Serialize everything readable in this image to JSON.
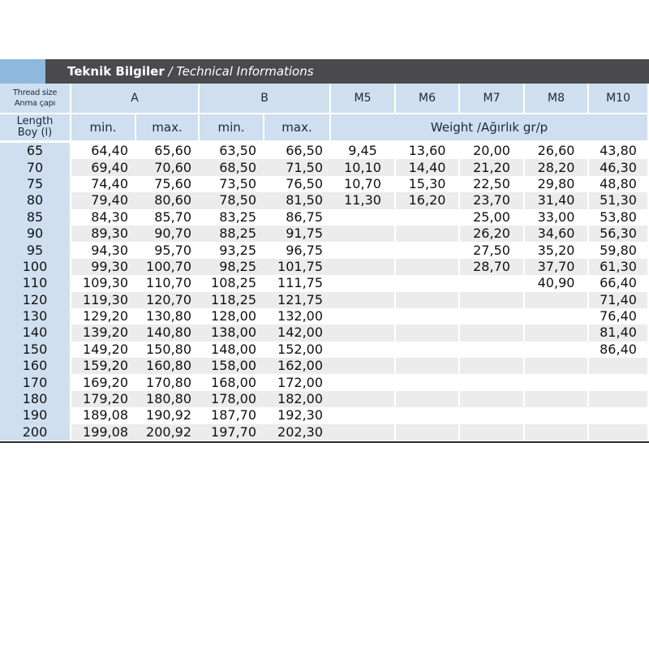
{
  "banner": {
    "title_tr": "Teknik Bilgiler",
    "separator": " / ",
    "title_en": "Technical Informations",
    "accent_color": "#8fb8de",
    "bar_color": "#4a4a4c"
  },
  "header": {
    "thread_size_en": "Thread size",
    "thread_size_tr": "Anma çapı",
    "col_a": "A",
    "col_b": "B",
    "threads": [
      "M5",
      "M6",
      "M7",
      "M8",
      "M10"
    ],
    "length_en": "Length",
    "length_tr": "Boy (l)",
    "min": "min.",
    "max": "max.",
    "weight": "Weight /Ağırlık gr/p"
  },
  "rows": [
    {
      "length": "65",
      "a_min": "64,40",
      "a_max": "65,60",
      "b_min": "63,50",
      "b_max": "66,50",
      "w": [
        "9,45",
        "13,60",
        "20,00",
        "26,60",
        "43,80"
      ]
    },
    {
      "length": "70",
      "a_min": "69,40",
      "a_max": "70,60",
      "b_min": "68,50",
      "b_max": "71,50",
      "w": [
        "10,10",
        "14,40",
        "21,20",
        "28,20",
        "46,30"
      ]
    },
    {
      "length": "75",
      "a_min": "74,40",
      "a_max": "75,60",
      "b_min": "73,50",
      "b_max": "76,50",
      "w": [
        "10,70",
        "15,30",
        "22,50",
        "29,80",
        "48,80"
      ]
    },
    {
      "length": "80",
      "a_min": "79,40",
      "a_max": "80,60",
      "b_min": "78,50",
      "b_max": "81,50",
      "w": [
        "11,30",
        "16,20",
        "23,70",
        "31,40",
        "51,30"
      ]
    },
    {
      "length": "85",
      "a_min": "84,30",
      "a_max": "85,70",
      "b_min": "83,25",
      "b_max": "86,75",
      "w": [
        "",
        "",
        "25,00",
        "33,00",
        "53,80"
      ]
    },
    {
      "length": "90",
      "a_min": "89,30",
      "a_max": "90,70",
      "b_min": "88,25",
      "b_max": "91,75",
      "w": [
        "",
        "",
        "26,20",
        "34,60",
        "56,30"
      ]
    },
    {
      "length": "95",
      "a_min": "94,30",
      "a_max": "95,70",
      "b_min": "93,25",
      "b_max": "96,75",
      "w": [
        "",
        "",
        "27,50",
        "35,20",
        "59,80"
      ]
    },
    {
      "length": "100",
      "a_min": "99,30",
      "a_max": "100,70",
      "b_min": "98,25",
      "b_max": "101,75",
      "w": [
        "",
        "",
        "28,70",
        "37,70",
        "61,30"
      ]
    },
    {
      "length": "110",
      "a_min": "109,30",
      "a_max": "110,70",
      "b_min": "108,25",
      "b_max": "111,75",
      "w": [
        "",
        "",
        "",
        "40,90",
        "66,40"
      ]
    },
    {
      "length": "120",
      "a_min": "119,30",
      "a_max": "120,70",
      "b_min": "118,25",
      "b_max": "121,75",
      "w": [
        "",
        "",
        "",
        "",
        "71,40"
      ]
    },
    {
      "length": "130",
      "a_min": "129,20",
      "a_max": "130,80",
      "b_min": "128,00",
      "b_max": "132,00",
      "w": [
        "",
        "",
        "",
        "",
        "76,40"
      ]
    },
    {
      "length": "140",
      "a_min": "139,20",
      "a_max": "140,80",
      "b_min": "138,00",
      "b_max": "142,00",
      "w": [
        "",
        "",
        "",
        "",
        "81,40"
      ]
    },
    {
      "length": "150",
      "a_min": "149,20",
      "a_max": "150,80",
      "b_min": "148,00",
      "b_max": "152,00",
      "w": [
        "",
        "",
        "",
        "",
        "86,40"
      ]
    },
    {
      "length": "160",
      "a_min": "159,20",
      "a_max": "160,80",
      "b_min": "158,00",
      "b_max": "162,00",
      "w": [
        "",
        "",
        "",
        "",
        ""
      ]
    },
    {
      "length": "170",
      "a_min": "169,20",
      "a_max": "170,80",
      "b_min": "168,00",
      "b_max": "172,00",
      "w": [
        "",
        "",
        "",
        "",
        ""
      ]
    },
    {
      "length": "180",
      "a_min": "179,20",
      "a_max": "180,80",
      "b_min": "178,00",
      "b_max": "182,00",
      "w": [
        "",
        "",
        "",
        "",
        ""
      ]
    },
    {
      "length": "190",
      "a_min": "189,08",
      "a_max": "190,92",
      "b_min": "187,70",
      "b_max": "192,30",
      "w": [
        "",
        "",
        "",
        "",
        ""
      ]
    },
    {
      "length": "200",
      "a_min": "199,08",
      "a_max": "200,92",
      "b_min": "197,70",
      "b_max": "202,30",
      "w": [
        "",
        "",
        "",
        "",
        ""
      ]
    }
  ]
}
